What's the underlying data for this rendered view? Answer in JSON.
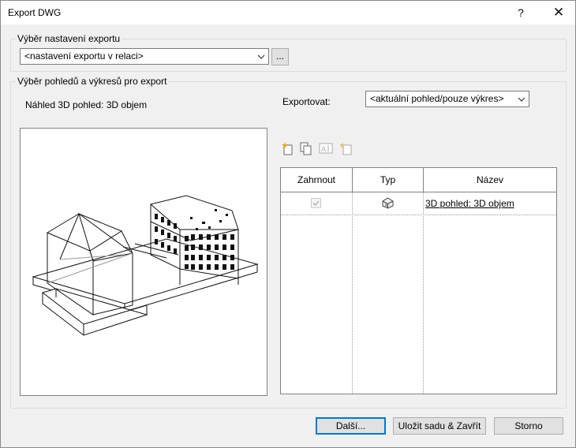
{
  "window": {
    "title": "Export DWG",
    "help_label": "?",
    "close_label": "✕"
  },
  "setup_group": {
    "label": "Výběr nastavení exportu",
    "combo_value": "<nastavení exportu v relaci>",
    "browse_label": "..."
  },
  "views_group": {
    "label": "Výběr pohledů a výkresů pro export",
    "preview_label": "Náhled 3D pohled: 3D objem",
    "export_label": "Exportovat:",
    "export_value": "<aktuální pohled/pouze výkres>",
    "toolbar_icons": [
      "new-set-icon",
      "duplicate-set-icon",
      "rename-set-icon",
      "delete-set-icon"
    ]
  },
  "table": {
    "headers": [
      "Zahrnout",
      "Typ",
      "Název"
    ],
    "rows": [
      {
        "include": true,
        "type_icon": "3d-view-icon",
        "name": "3D pohled: 3D objem"
      }
    ]
  },
  "buttons": {
    "next": "Další...",
    "save_close": "Uložit sadu & Zavřít",
    "cancel": "Storno"
  }
}
